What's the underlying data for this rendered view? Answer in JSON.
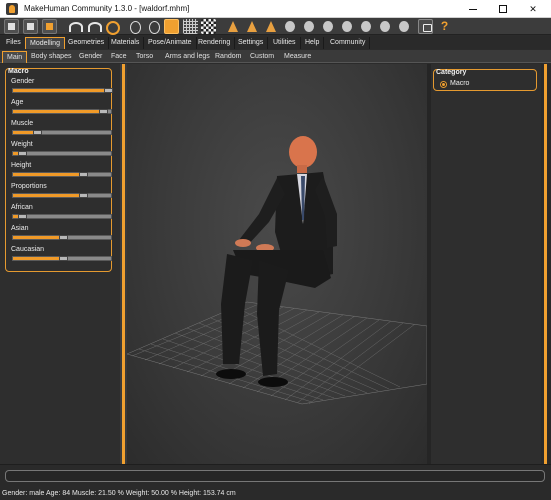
{
  "window": {
    "title": "MakeHuman Community 1.3.0 - [waldorf.mhm]",
    "controls": {
      "minimize": "—",
      "maximize": "☐",
      "close": "✕"
    }
  },
  "toolbar": {
    "icons": [
      "file-icon",
      "folder-icon",
      "save-icon",
      "undo-icon",
      "redo-icon",
      "reset-icon",
      "smooth-icon",
      "pose-icon",
      "wireframe-icon",
      "background-icon",
      "front-view-icon",
      "back-view-icon",
      "left-view-icon",
      "right-view-icon",
      "top-view-icon",
      "bottom-view-icon",
      "reset-camera-icon",
      "screenshot-icon"
    ],
    "help_label": "?"
  },
  "menu_tabs": [
    {
      "label": "Files",
      "active": false
    },
    {
      "label": "Modelling",
      "active": true
    },
    {
      "label": "Geometries",
      "active": false
    },
    {
      "label": "Materials",
      "active": false
    },
    {
      "label": "Pose/Animate",
      "active": false
    },
    {
      "label": "Rendering",
      "active": false
    },
    {
      "label": "Settings",
      "active": false
    },
    {
      "label": "Utilities",
      "active": false
    },
    {
      "label": "Help",
      "active": false
    },
    {
      "label": "Community",
      "active": false
    }
  ],
  "sub_tabs": [
    {
      "label": "Main",
      "active": true
    },
    {
      "label": "Body shapes",
      "active": false
    },
    {
      "label": "Gender",
      "active": false
    },
    {
      "label": "Face",
      "active": false
    },
    {
      "label": "Torso",
      "active": false
    },
    {
      "label": "Arms and legs",
      "active": false
    },
    {
      "label": "Random",
      "active": false
    },
    {
      "label": "Custom",
      "active": false
    },
    {
      "label": "Measure",
      "active": false
    }
  ],
  "macro": {
    "title": "Macro",
    "sliders": [
      {
        "label": "Gender",
        "value": 1.0
      },
      {
        "label": "Age",
        "value": 0.94
      },
      {
        "label": "Muscle",
        "value": 0.215
      },
      {
        "label": "Weight",
        "value": 0.05
      },
      {
        "label": "Height",
        "value": 0.72
      },
      {
        "label": "Proportions",
        "value": 0.72
      },
      {
        "label": "African",
        "value": 0.05
      },
      {
        "label": "Asian",
        "value": 0.5
      },
      {
        "label": "Caucasian",
        "value": 0.5
      }
    ]
  },
  "category": {
    "title": "Category",
    "option": "Macro"
  },
  "status_bar": "Gender: male  Age: 84  Muscle: 21.50 %  Weight: 50.00 %  Height: 153.74 cm",
  "colors": {
    "accent": "#f0a030",
    "panel": "#2e2e2e",
    "viewport": "#3d3d3d"
  }
}
